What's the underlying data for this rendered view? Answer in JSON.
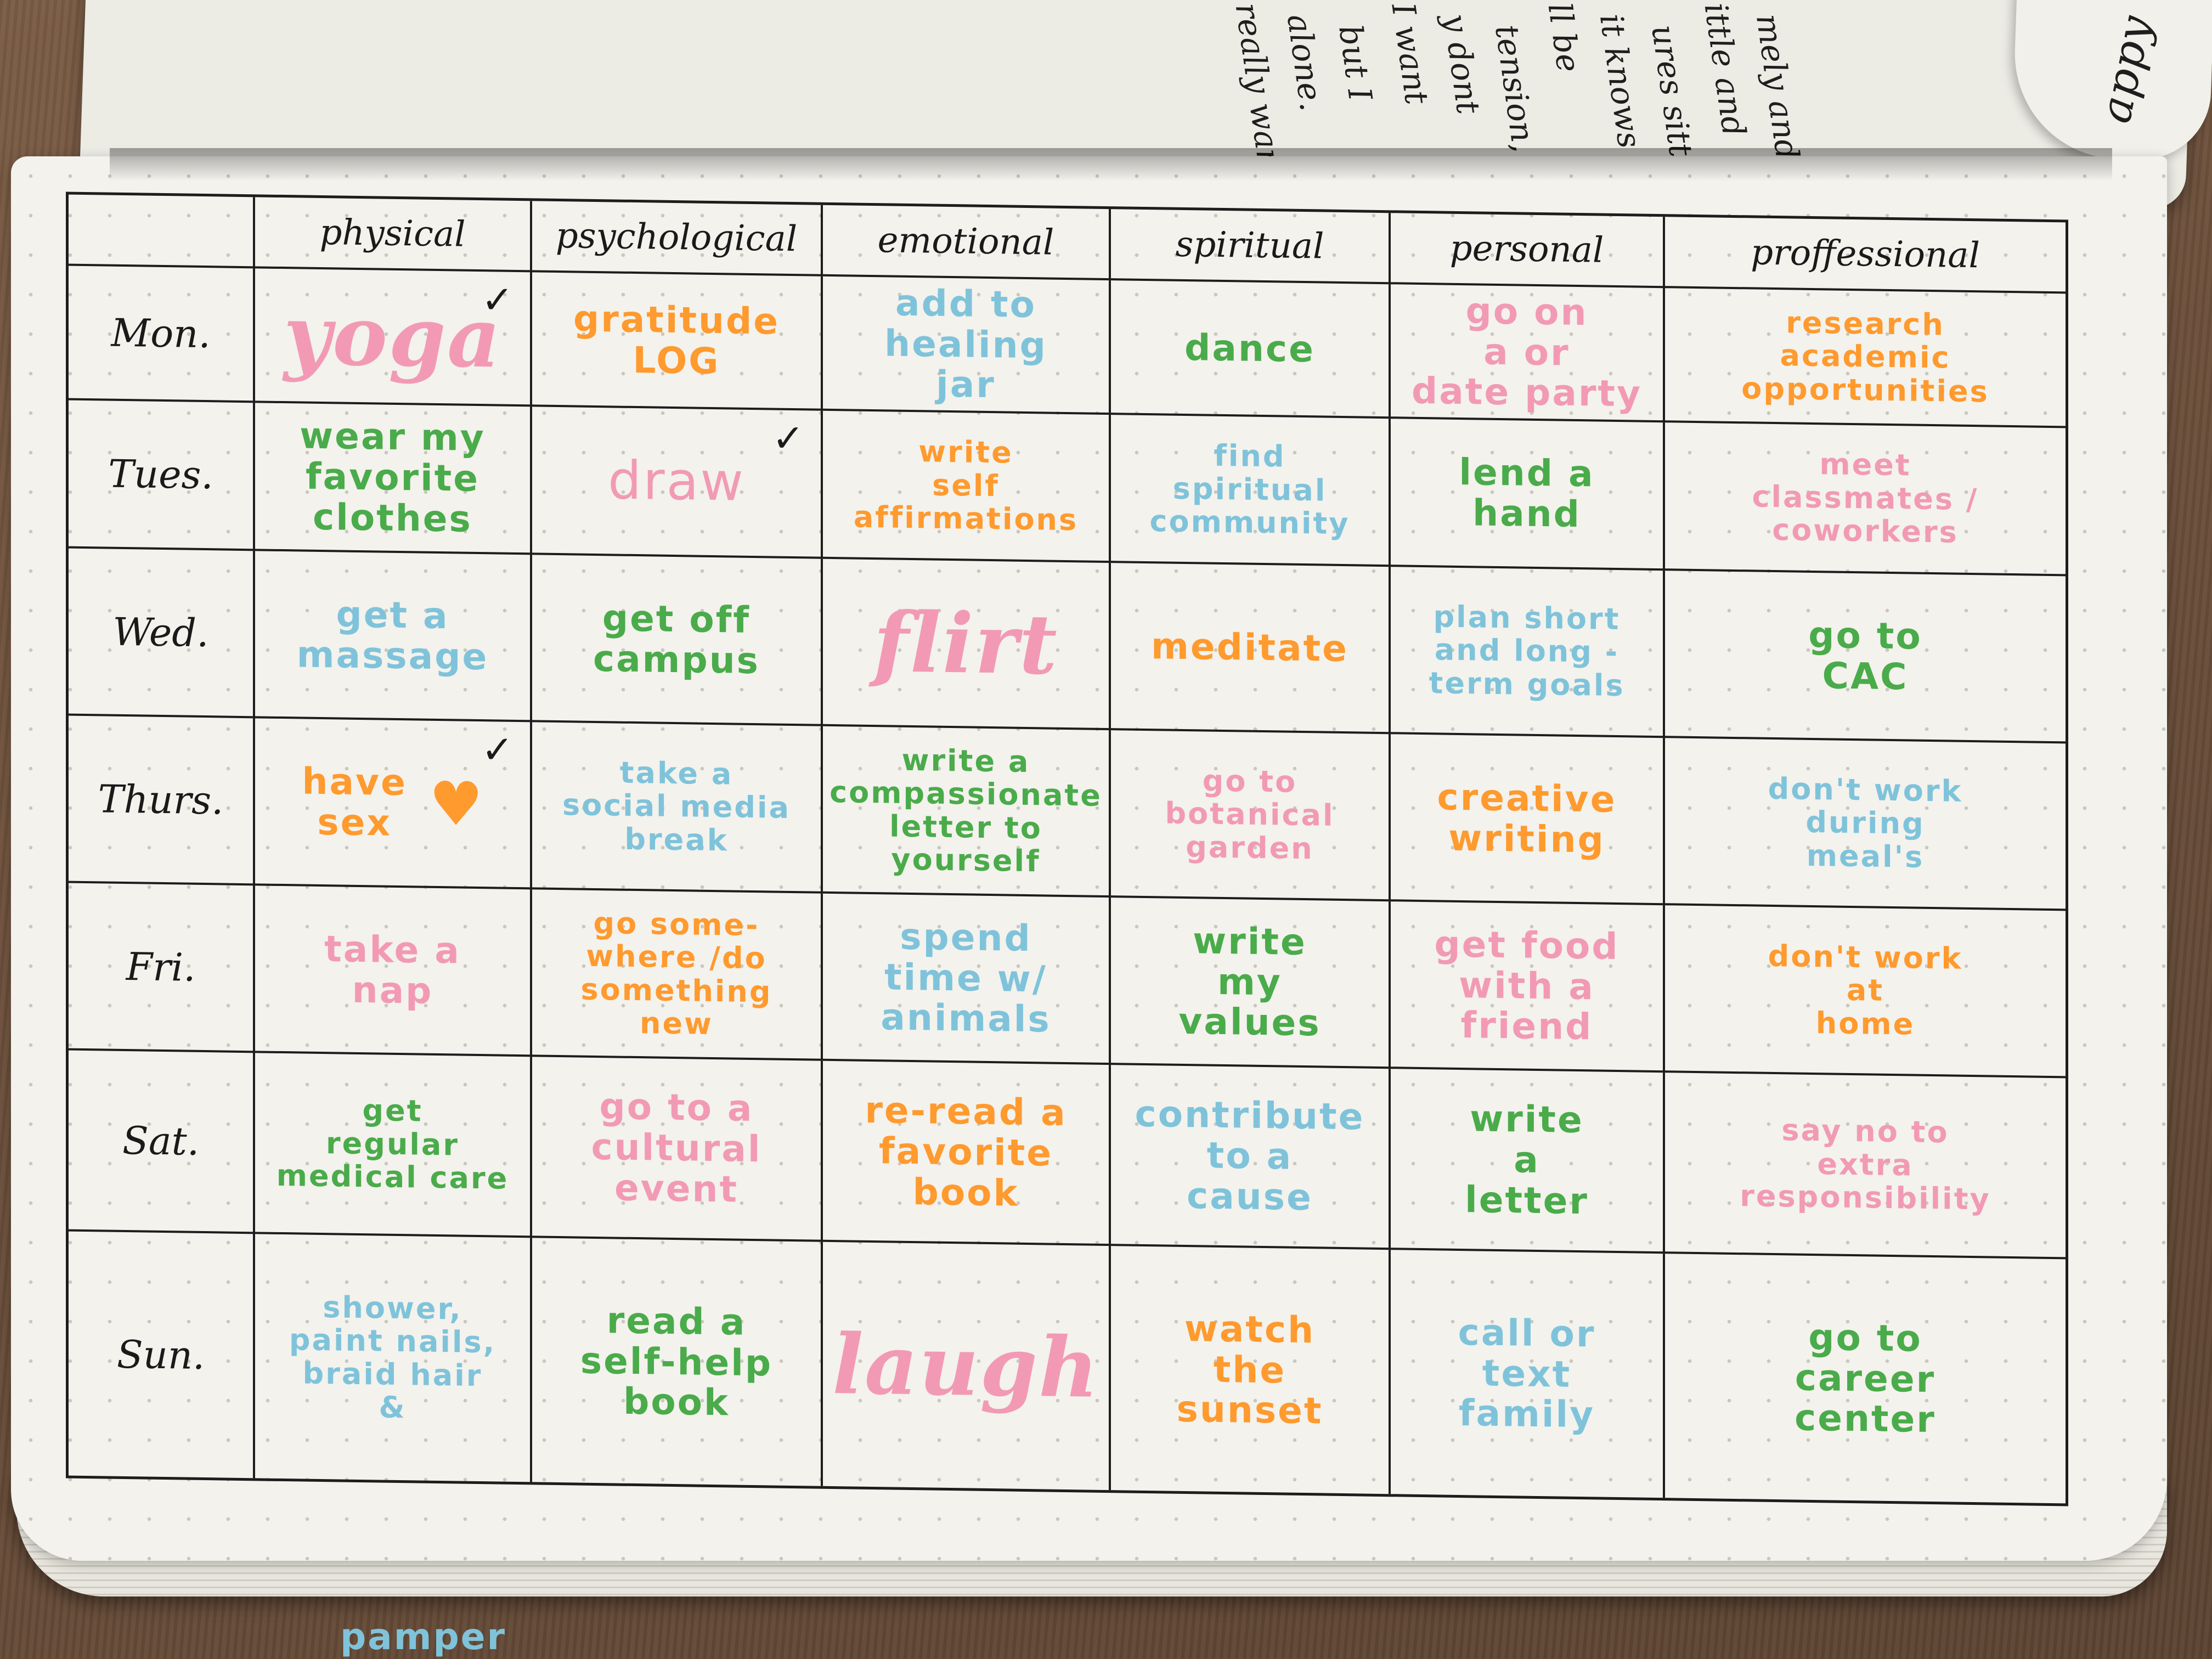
{
  "facing_page": {
    "handwriting_lines": [
      "really want",
      "alone.",
      "but I",
      "I want",
      "y dont",
      "tension,",
      "ll be",
      "it knows",
      "ures sitting",
      "ittle and",
      "mely and"
    ],
    "corner_text": "appy"
  },
  "planner": {
    "columns": [
      "physical",
      "psychological",
      "emotional",
      "spiritual",
      "personal",
      "proffessional"
    ],
    "rows": [
      {
        "day": "Mon.",
        "cells": [
          {
            "text": "yoga",
            "color": "#f29ab5",
            "style": "big",
            "checked": true
          },
          {
            "text": "gratitude\nLOG",
            "color": "#ff9a2e"
          },
          {
            "text": "add to\nhealing\njar",
            "color": "#7fc3da"
          },
          {
            "text": "dance",
            "color": "#4aab4a"
          },
          {
            "text": "go on\na   or\ndate party",
            "color": "#f29ab5"
          },
          {
            "text": "research\nacademic\nopportunities",
            "color": "#ff9a2e",
            "style": "small"
          }
        ]
      },
      {
        "day": "Tues.",
        "cells": [
          {
            "text": "wear my\nfavorite\nclothes",
            "color": "#4aab4a"
          },
          {
            "text": "draw",
            "color": "#f29ab5",
            "checked": true,
            "style": "mid"
          },
          {
            "text": "write\nself\naffirmations",
            "color": "#ff9a2e",
            "style": "small"
          },
          {
            "text": "find\nspiritual\ncommunity",
            "color": "#7fc3da",
            "style": "small"
          },
          {
            "text": "lend a\nhand",
            "color": "#4aab4a"
          },
          {
            "text": "meet\nclassmates /\ncoworkers",
            "color": "#f29ab5",
            "style": "small"
          }
        ]
      },
      {
        "day": "Wed.",
        "cells": [
          {
            "text": "get a\nmassage",
            "color": "#7fc3da"
          },
          {
            "text": "get off\ncampus",
            "color": "#4aab4a"
          },
          {
            "text": "flirt",
            "color": "#f29ab5",
            "style": "big"
          },
          {
            "text": "meditate",
            "color": "#ff9a2e"
          },
          {
            "text": "plan short\nand long -\nterm goals",
            "color": "#7fc3da",
            "style": "small"
          },
          {
            "text": "go to\nCAC",
            "color": "#4aab4a"
          }
        ]
      },
      {
        "day": "Thurs.",
        "cells": [
          {
            "text": "have\nsex",
            "color": "#ff9a2e",
            "checked": true,
            "heart": true
          },
          {
            "text": "take a\nsocial media\nbreak",
            "color": "#7fc3da",
            "style": "small"
          },
          {
            "text": "write a\ncompassionate\nletter to\nyourself",
            "color": "#4aab4a",
            "style": "small"
          },
          {
            "text": "go to\nbotanical\ngarden",
            "color": "#f29ab5",
            "style": "small"
          },
          {
            "text": "creative\nwriting",
            "color": "#ff9a2e"
          },
          {
            "text": "don't work\nduring\nmeal's",
            "color": "#7fc3da",
            "style": "small"
          }
        ]
      },
      {
        "day": "Fri.",
        "cells": [
          {
            "text": "take a\nnap",
            "color": "#f29ab5"
          },
          {
            "text": "go some-\nwhere /do\nsomething new",
            "color": "#ff9a2e",
            "style": "small"
          },
          {
            "text": "spend\ntime w/\nanimals",
            "color": "#7fc3da"
          },
          {
            "text": "write\nmy\nvalues",
            "color": "#4aab4a"
          },
          {
            "text": "get food\nwith a\nfriend",
            "color": "#f29ab5"
          },
          {
            "text": "don't work\nat\nhome",
            "color": "#ff9a2e",
            "style": "small"
          }
        ]
      },
      {
        "day": "Sat.",
        "cells": [
          {
            "text": "get\nregular\nmedical care",
            "color": "#4aab4a",
            "style": "small"
          },
          {
            "text": "go to a\ncultural\nevent",
            "color": "#f29ab5"
          },
          {
            "text": "re-read a\nfavorite\nbook",
            "color": "#ff9a2e"
          },
          {
            "text": "contribute\nto a\ncause",
            "color": "#7fc3da"
          },
          {
            "text": "write\na\nletter",
            "color": "#4aab4a"
          },
          {
            "text": "say no to\nextra\nresponsibility",
            "color": "#f29ab5",
            "style": "small"
          }
        ]
      },
      {
        "day": "Sun.",
        "cells": [
          {
            "text": "shower,\npaint nails,\nbraid hair\n&",
            "color": "#7fc3da",
            "style": "small"
          },
          {
            "text": "read a\nself-help\nbook",
            "color": "#4aab4a"
          },
          {
            "text": "laugh",
            "color": "#f29ab5",
            "style": "big"
          },
          {
            "text": "watch\nthe\nsunset",
            "color": "#ff9a2e"
          },
          {
            "text": "call or\ntext\nfamily",
            "color": "#7fc3da"
          },
          {
            "text": "go to\ncareer\ncenter",
            "color": "#4aab4a"
          }
        ]
      }
    ],
    "overflow_text": "pamper",
    "overflow_color": "#7fc3da"
  }
}
